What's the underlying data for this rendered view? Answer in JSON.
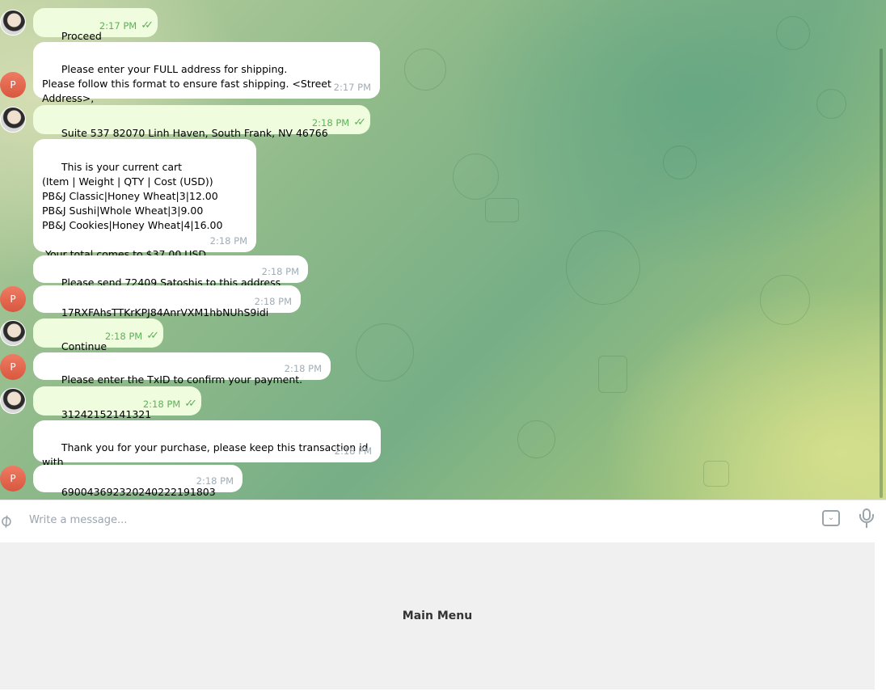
{
  "messages": [
    {
      "text": "Proceed",
      "time": "2:17 PM",
      "read": "✓✓"
    },
    {
      "text": "Please enter your FULL address for shipping.\nPlease follow this format to ensure fast shipping. <Street Address>,\n<City>, <State> <ZipCode>",
      "time": "2:17 PM",
      "avatar": "P"
    },
    {
      "text": "Suite 537 82070 Linh Haven, South Frank, NV 46766",
      "time": "2:18 PM",
      "read": "✓✓"
    },
    {
      "text": "This is your current cart\n(Item | Weight | QTY | Cost (USD))\nPB&J Classic|Honey Wheat|3|12.00\nPB&J Sushi|Whole Wheat|3|9.00\nPB&J Cookies|Honey Wheat|4|16.00\n\n Your total comes to $37.00 USD",
      "time": "2:18 PM"
    },
    {
      "text": "Please send 72409 Satoshis to this address",
      "time": "2:18 PM"
    },
    {
      "text": "17RXFAhsTTKrKPJ84AnrVXM1hbNUhS9idi",
      "time": "2:18 PM",
      "avatar": "P"
    },
    {
      "text": "Continue",
      "time": "2:18 PM",
      "read": "✓✓"
    },
    {
      "text": "Please enter the TxID to confirm your payment.",
      "time": "2:18 PM",
      "avatar": "P"
    },
    {
      "text": "31242152141321",
      "time": "2:18 PM",
      "read": "✓✓"
    },
    {
      "text": "Thank you for your purchase, please keep this transaction id with\nyou.",
      "time": "2:18 PM"
    },
    {
      "text": "690043692320240222191803",
      "time": "2:18 PM",
      "avatar": "P"
    }
  ],
  "composer": {
    "placeholder": "Write a message...",
    "attach_icon": "paperclip-icon",
    "keyboard_icon": "bot-keyboard-icon",
    "mic_icon": "microphone-icon"
  },
  "keyboard": {
    "main_menu_label": "Main Menu"
  },
  "colors": {
    "outgoing_bubble": "#effdde",
    "incoming_bubble": "#ffffff",
    "read_ticks": "#5fb05a",
    "avatar_letter_bg": "#e3664d"
  }
}
